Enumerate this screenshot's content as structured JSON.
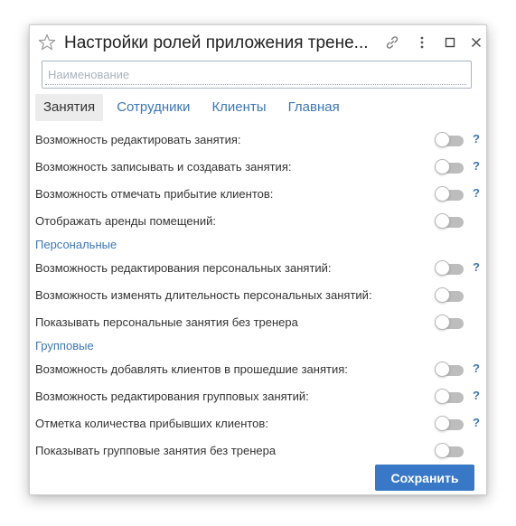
{
  "window": {
    "title": "Настройки ролей приложения трене...",
    "colors": {
      "accent": "#3878c7",
      "link": "#3d76b8",
      "toggle_off": "#bdbdbd"
    }
  },
  "titlebar_icons": [
    "star-icon",
    "link-icon",
    "more-icon",
    "maximize-icon",
    "close-icon"
  ],
  "search": {
    "placeholder": "Наименование",
    "value": ""
  },
  "tabs": [
    {
      "label": "Занятия",
      "active": true
    },
    {
      "label": "Сотрудники",
      "active": false
    },
    {
      "label": "Клиенты",
      "active": false
    },
    {
      "label": "Главная",
      "active": false
    }
  ],
  "rows": [
    {
      "label": "Возможность редактировать занятия:",
      "on": false,
      "help": "?"
    },
    {
      "label": "Возможность записывать и создавать занятия:",
      "on": false,
      "help": "?"
    },
    {
      "label": "Возможность отмечать прибытие клиентов:",
      "on": false,
      "help": "?"
    },
    {
      "label": "Отображать аренды помещений:",
      "on": false
    }
  ],
  "sections": {
    "personal": {
      "title": "Персональные",
      "rows": [
        {
          "label": "Возможность редактирования персональных занятий:",
          "on": false,
          "help": "?"
        },
        {
          "label": "Возможность изменять длительность персональных занятий:",
          "on": false
        },
        {
          "label": "Показывать персональные занятия без тренера",
          "on": false
        }
      ]
    },
    "group": {
      "title": "Групповые",
      "rows": [
        {
          "label": "Возможность добавлять клиентов в прошедшие занятия:",
          "on": false,
          "help": "?"
        },
        {
          "label": "Возможность редактирования групповых занятий:",
          "on": false,
          "help": "?"
        },
        {
          "label": "Отметка количества прибывших клиентов:",
          "on": false,
          "help": "?"
        },
        {
          "label": "Показывать групповые занятия без тренера",
          "on": false
        }
      ]
    }
  },
  "footer": {
    "save_label": "Сохранить"
  }
}
